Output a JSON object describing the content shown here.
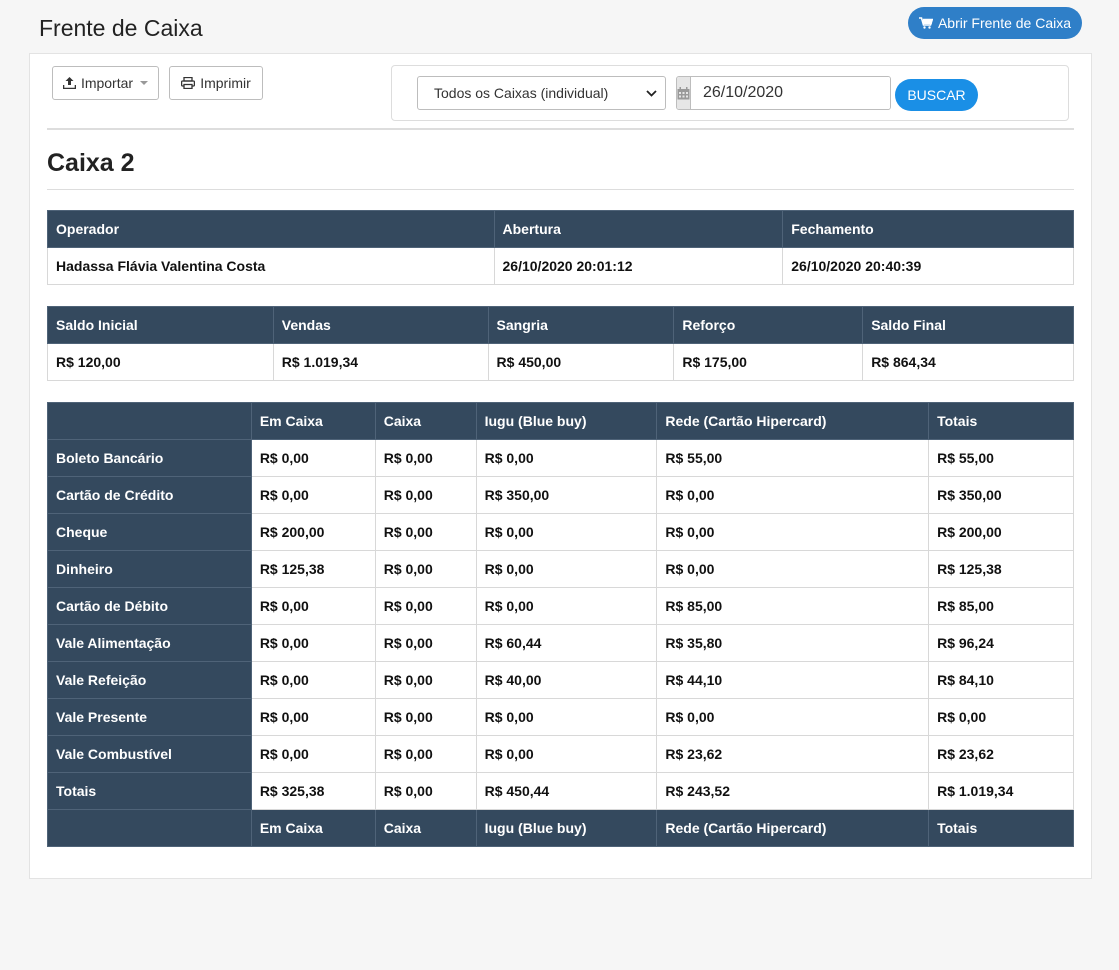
{
  "header": {
    "title": "Frente de Caixa",
    "open_button_label": "Abrir Frente de Caixa"
  },
  "toolbar": {
    "import_label": "Importar",
    "print_label": "Imprimir"
  },
  "filter": {
    "select_value": "Todos os Caixas (individual)",
    "date_value": "26/10/2020",
    "search_label": "BUSCAR"
  },
  "caixa": {
    "title": "Caixa 2"
  },
  "session": {
    "headers": [
      "Operador",
      "Abertura",
      "Fechamento"
    ],
    "operator": "Hadassa Flávia Valentina Costa",
    "opened": "26/10/2020 20:01:12",
    "closed": "26/10/2020 20:40:39"
  },
  "summary": {
    "headers": [
      "Saldo Inicial",
      "Vendas",
      "Sangria",
      "Reforço",
      "Saldo Final"
    ],
    "values": [
      "R$ 120,00",
      "R$ 1.019,34",
      "R$ 450,00",
      "R$ 175,00",
      "R$ 864,34"
    ]
  },
  "payments": {
    "headers": [
      "",
      "Em Caixa",
      "Caixa",
      "Iugu (Blue buy)",
      "Rede (Cartão Hipercard)",
      "Totais"
    ],
    "rows": [
      {
        "label": "Boleto Bancário",
        "cells": [
          "R$ 0,00",
          "R$ 0,00",
          "R$ 0,00",
          "R$ 55,00",
          "R$ 55,00"
        ]
      },
      {
        "label": "Cartão de Crédito",
        "cells": [
          "R$ 0,00",
          "R$ 0,00",
          "R$ 350,00",
          "R$ 0,00",
          "R$ 350,00"
        ]
      },
      {
        "label": "Cheque",
        "cells": [
          "R$ 200,00",
          "R$ 0,00",
          "R$ 0,00",
          "R$ 0,00",
          "R$ 200,00"
        ]
      },
      {
        "label": "Dinheiro",
        "cells": [
          "R$ 125,38",
          "R$ 0,00",
          "R$ 0,00",
          "R$ 0,00",
          "R$ 125,38"
        ]
      },
      {
        "label": "Cartão de Débito",
        "cells": [
          "R$ 0,00",
          "R$ 0,00",
          "R$ 0,00",
          "R$ 85,00",
          "R$ 85,00"
        ]
      },
      {
        "label": "Vale Alimentação",
        "cells": [
          "R$ 0,00",
          "R$ 0,00",
          "R$ 60,44",
          "R$ 35,80",
          "R$ 96,24"
        ]
      },
      {
        "label": "Vale Refeição",
        "cells": [
          "R$ 0,00",
          "R$ 0,00",
          "R$ 40,00",
          "R$ 44,10",
          "R$ 84,10"
        ]
      },
      {
        "label": "Vale Presente",
        "cells": [
          "R$ 0,00",
          "R$ 0,00",
          "R$ 0,00",
          "R$ 0,00",
          "R$ 0,00"
        ]
      },
      {
        "label": "Vale Combustível",
        "cells": [
          "R$ 0,00",
          "R$ 0,00",
          "R$ 0,00",
          "R$ 23,62",
          "R$ 23,62"
        ]
      },
      {
        "label": "Totais",
        "cells": [
          "R$ 325,38",
          "R$ 0,00",
          "R$ 450,44",
          "R$ 243,52",
          "R$ 1.019,34"
        ]
      }
    ]
  }
}
